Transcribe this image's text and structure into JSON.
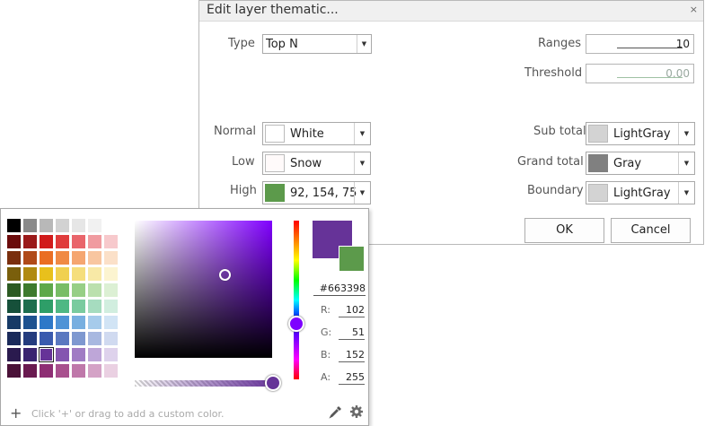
{
  "dialog": {
    "title": "Edit layer thematic...",
    "close_glyph": "×",
    "type_label": "Type",
    "type_value": "Top N",
    "ranges_label": "Ranges",
    "ranges_value": "10",
    "threshold_label": "Threshold",
    "threshold_value": "0.00",
    "normal_label": "Normal",
    "normal_value": "White",
    "normal_color": "#ffffff",
    "low_label": "Low",
    "low_value": "Snow",
    "low_color": "#fffafa",
    "high_label": "High",
    "high_value": "92, 154, 75",
    "high_color": "#5c9a4b",
    "subtotal_label": "Sub total",
    "subtotal_value": "LightGray",
    "subtotal_color": "#d3d3d3",
    "grandtotal_label": "Grand total",
    "grandtotal_value": "Gray",
    "grandtotal_color": "#808080",
    "boundary_label": "Boundary",
    "boundary_value": "LightGray",
    "boundary_color": "#d3d3d3",
    "ok_label": "OK",
    "cancel_label": "Cancel"
  },
  "picker": {
    "hex": "#663398",
    "r_label": "R:",
    "r": "102",
    "g_label": "G:",
    "g": "51",
    "b_label": "B:",
    "b": "152",
    "a_label": "A:",
    "a": "255",
    "new_color": "#663398",
    "old_color": "#5c9a4b",
    "add_glyph": "+",
    "hint": "Click '+' or drag to add a custom color.",
    "selected_swatch": "#663398",
    "palette": [
      [
        "#000000",
        "#8a8a8a",
        "#b8b8b8",
        "#d2d2d2",
        "#e6e6e6",
        "#f1f1f1",
        "#ffffff"
      ],
      [
        "#6b0c0c",
        "#9b1a1a",
        "#d11b1b",
        "#e03c3c",
        "#e9656b",
        "#f09ba0",
        "#f7c9cc"
      ],
      [
        "#7a2f0e",
        "#b04a18",
        "#ea6e22",
        "#f08a44",
        "#f5a670",
        "#f8c6a0",
        "#fbe0c8"
      ],
      [
        "#7a5f0c",
        "#b08a10",
        "#e8c01c",
        "#f0d050",
        "#f5de7c",
        "#f8e9a6",
        "#fcf4d0"
      ],
      [
        "#2c5a22",
        "#3e7a2e",
        "#5ea84a",
        "#78bd66",
        "#97cf86",
        "#bbe0ae",
        "#dcf0d4"
      ],
      [
        "#16503a",
        "#1e6e4e",
        "#2e9e68",
        "#4fb884",
        "#7acb9f",
        "#a6dcbf",
        "#d1eedf"
      ],
      [
        "#163a66",
        "#1e5290",
        "#2e78c8",
        "#4f93d6",
        "#78afe0",
        "#a6cbeb",
        "#d1e4f5"
      ],
      [
        "#1a2a5a",
        "#243c7e",
        "#3a5aae",
        "#5a78c0",
        "#7e98d0",
        "#a8b8e0",
        "#d0daf0"
      ],
      [
        "#2a1a4e",
        "#3a2470",
        "#663398",
        "#8456b0",
        "#a07cc4",
        "#bea6d8",
        "#ded2ec"
      ],
      [
        "#4a1238",
        "#6a1a50",
        "#8e2e74",
        "#a8508e",
        "#bf78aa",
        "#d4a2c6",
        "#ead0e2"
      ]
    ]
  }
}
